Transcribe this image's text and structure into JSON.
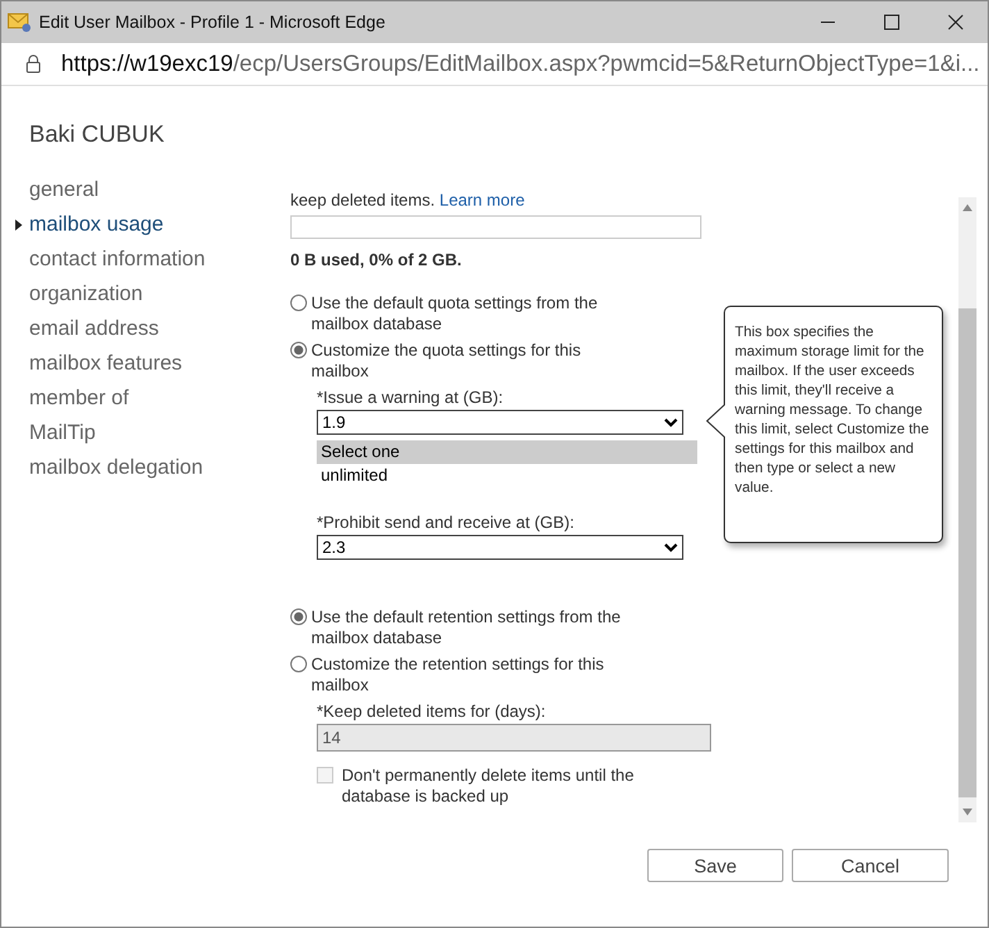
{
  "window": {
    "title": "Edit User Mailbox - Profile 1 - Microsoft Edge"
  },
  "address_bar": {
    "host": "https://w19exc19",
    "path": "/ecp/UsersGroups/EditMailbox.aspx?pwmcid=5&ReturnObjectType=1&i..."
  },
  "user_name": "Baki CUBUK",
  "sidebar": {
    "items": [
      {
        "label": "general",
        "selected": false
      },
      {
        "label": "mailbox usage",
        "selected": true
      },
      {
        "label": "contact information",
        "selected": false
      },
      {
        "label": "organization",
        "selected": false
      },
      {
        "label": "email address",
        "selected": false
      },
      {
        "label": "mailbox features",
        "selected": false
      },
      {
        "label": "member of",
        "selected": false
      },
      {
        "label": "MailTip",
        "selected": false
      },
      {
        "label": "mailbox delegation",
        "selected": false
      }
    ]
  },
  "intro": {
    "text": "keep deleted items.",
    "link": "Learn more"
  },
  "usage": {
    "reading": "0 B used, 0% of 2 GB."
  },
  "quota_options": [
    {
      "label": "Use the default quota settings from the mailbox database",
      "selected": false
    },
    {
      "label": "Customize the quota settings for this mailbox",
      "selected": true
    }
  ],
  "warning": {
    "label": "*Issue a warning at (GB):",
    "value": "1.9",
    "open_options": [
      {
        "label": "Select one",
        "selected": true
      },
      {
        "label": "unlimited",
        "selected": false
      }
    ]
  },
  "prohibit": {
    "label": "*Prohibit send and receive at (GB):",
    "value": "2.3"
  },
  "retention_options": [
    {
      "label": "Use the default retention settings from the mailbox database",
      "selected": true
    },
    {
      "label": "Customize the retention settings for this mailbox",
      "selected": false
    }
  ],
  "keep_deleted": {
    "label": "*Keep deleted items for (days):",
    "value": "14",
    "disabled": true
  },
  "backup_checkbox": {
    "label": "Don't permanently delete items until the database is backed up",
    "checked": false,
    "disabled": true
  },
  "tooltip": "This box specifies the maximum storage limit for the mailbox. If the user exceeds this limit, they'll receive a warning message. To change this limit, select Customize the settings for this mailbox and then type or select a new value.",
  "buttons": [
    "Save",
    "Cancel"
  ]
}
